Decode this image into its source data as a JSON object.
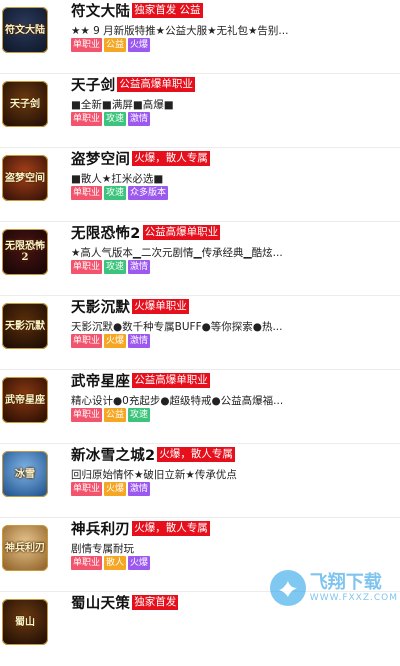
{
  "games": [
    {
      "title": "符文大陆",
      "badge": "独家首发 公益",
      "desc": "★★ 9 月新版特推★公益大服★无礼包★告别...",
      "icon_text": "符文大陆",
      "icon_colors": [
        "#2a3b5c",
        "#0d1426"
      ],
      "tags": [
        {
          "label": "单职业",
          "color": "pink"
        },
        {
          "label": "公益",
          "color": "orange"
        },
        {
          "label": "火爆",
          "color": "purple"
        }
      ]
    },
    {
      "title": "天子剑",
      "badge": "公益高爆单职业",
      "desc": "■全新■满屏■高爆■",
      "icon_text": "天子剑",
      "icon_colors": [
        "#6b3a10",
        "#1c0b04"
      ],
      "tags": [
        {
          "label": "单职业",
          "color": "pink"
        },
        {
          "label": "攻速",
          "color": "green"
        },
        {
          "label": "激情",
          "color": "purple"
        }
      ]
    },
    {
      "title": "盗梦空间",
      "badge": "火爆，散人专属",
      "desc": "■散人★扛米必选■",
      "icon_text": "盗梦空间",
      "icon_colors": [
        "#a8421a",
        "#2a0d05"
      ],
      "tags": [
        {
          "label": "单职业",
          "color": "pink"
        },
        {
          "label": "攻速",
          "color": "green"
        },
        {
          "label": "众多版本",
          "color": "purple"
        }
      ]
    },
    {
      "title": "无限恐怖2",
      "badge": "公益高爆单职业",
      "desc": "★高人气版本▁二次元剧情▁传承经典▁酷炫...",
      "icon_text": "无限恐怖2",
      "icon_colors": [
        "#4a1414",
        "#120404"
      ],
      "tags": [
        {
          "label": "单职业",
          "color": "pink"
        },
        {
          "label": "攻速",
          "color": "green"
        },
        {
          "label": "激情",
          "color": "purple"
        }
      ]
    },
    {
      "title": "天影沉默",
      "badge": "火爆单职业",
      "desc": "天影沉默●数千种专属BUFF●等你探索●热...",
      "icon_text": "天影沉默",
      "icon_colors": [
        "#5a2e0c",
        "#160903"
      ],
      "tags": [
        {
          "label": "单职业",
          "color": "pink"
        },
        {
          "label": "火爆",
          "color": "orange"
        },
        {
          "label": "激情",
          "color": "purple"
        }
      ]
    },
    {
      "title": "武帝星座",
      "badge": "公益高爆单职业",
      "desc": "精心设计●0充起步●超级特戒●公益高爆福...",
      "icon_text": "武帝星座",
      "icon_colors": [
        "#8a3a12",
        "#220a02"
      ],
      "tags": [
        {
          "label": "单职业",
          "color": "pink"
        },
        {
          "label": "公益",
          "color": "orange"
        },
        {
          "label": "攻速",
          "color": "green"
        }
      ]
    },
    {
      "title": "新冰雪之城2",
      "badge": "火爆，散人专属",
      "desc": "回归原始情怀★破旧立新★传承优点",
      "icon_text": "冰雪",
      "icon_colors": [
        "#7fb6e8",
        "#1b4a86"
      ],
      "tags": [
        {
          "label": "单职业",
          "color": "pink"
        },
        {
          "label": "火爆",
          "color": "orange"
        },
        {
          "label": "激情",
          "color": "purple"
        }
      ]
    },
    {
      "title": "神兵利刃",
      "badge": "火爆，散人专属",
      "desc": "剧情专属耐玩",
      "icon_text": "神兵利刃",
      "icon_colors": [
        "#e8c890",
        "#8a5a20"
      ],
      "tags": [
        {
          "label": "单职业",
          "color": "pink"
        },
        {
          "label": "散人",
          "color": "orange"
        },
        {
          "label": "火爆",
          "color": "purple"
        }
      ]
    },
    {
      "title": "蜀山天策",
      "badge": "独家首发",
      "desc": "",
      "icon_text": "蜀山",
      "icon_colors": [
        "#6a3a12",
        "#1a0a02"
      ],
      "tags": []
    }
  ],
  "watermark": {
    "main": "飞翔下载",
    "sub": "WWW.FXXZ.COM",
    "color": "#2a9ee6"
  }
}
